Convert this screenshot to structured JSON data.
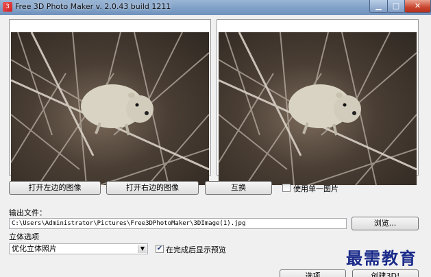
{
  "window": {
    "title": "Free 3D Photo Maker  v. 2.0.43 build 1211"
  },
  "panels": {
    "left": {
      "image": "rodent-photo"
    },
    "right": {
      "image": "rodent-photo"
    }
  },
  "buttons": {
    "open_left": "打开左边的图像",
    "open_right": "打开右边的图像",
    "swap": "互换",
    "browse": "浏览...",
    "options": "选项",
    "create": "创建3D!"
  },
  "single_image": {
    "label": "使用单一图片",
    "checked": false
  },
  "output": {
    "label": "输出文件：",
    "path": "C:\\Users\\Administrator\\Pictures\\Free3DPhotoMaker\\3DImage(1).jpg"
  },
  "stereo": {
    "label": "立体选项",
    "selected": "优化立体照片"
  },
  "preview": {
    "label": "在完成后显示预览",
    "checked": true
  },
  "watermark": "最需教育",
  "icons": {
    "app": "app-icon",
    "minimize": "minimize-icon",
    "maximize": "maximize-icon",
    "close": "close-icon",
    "dropdown": "chevron-down-icon",
    "check": "check-icon"
  }
}
